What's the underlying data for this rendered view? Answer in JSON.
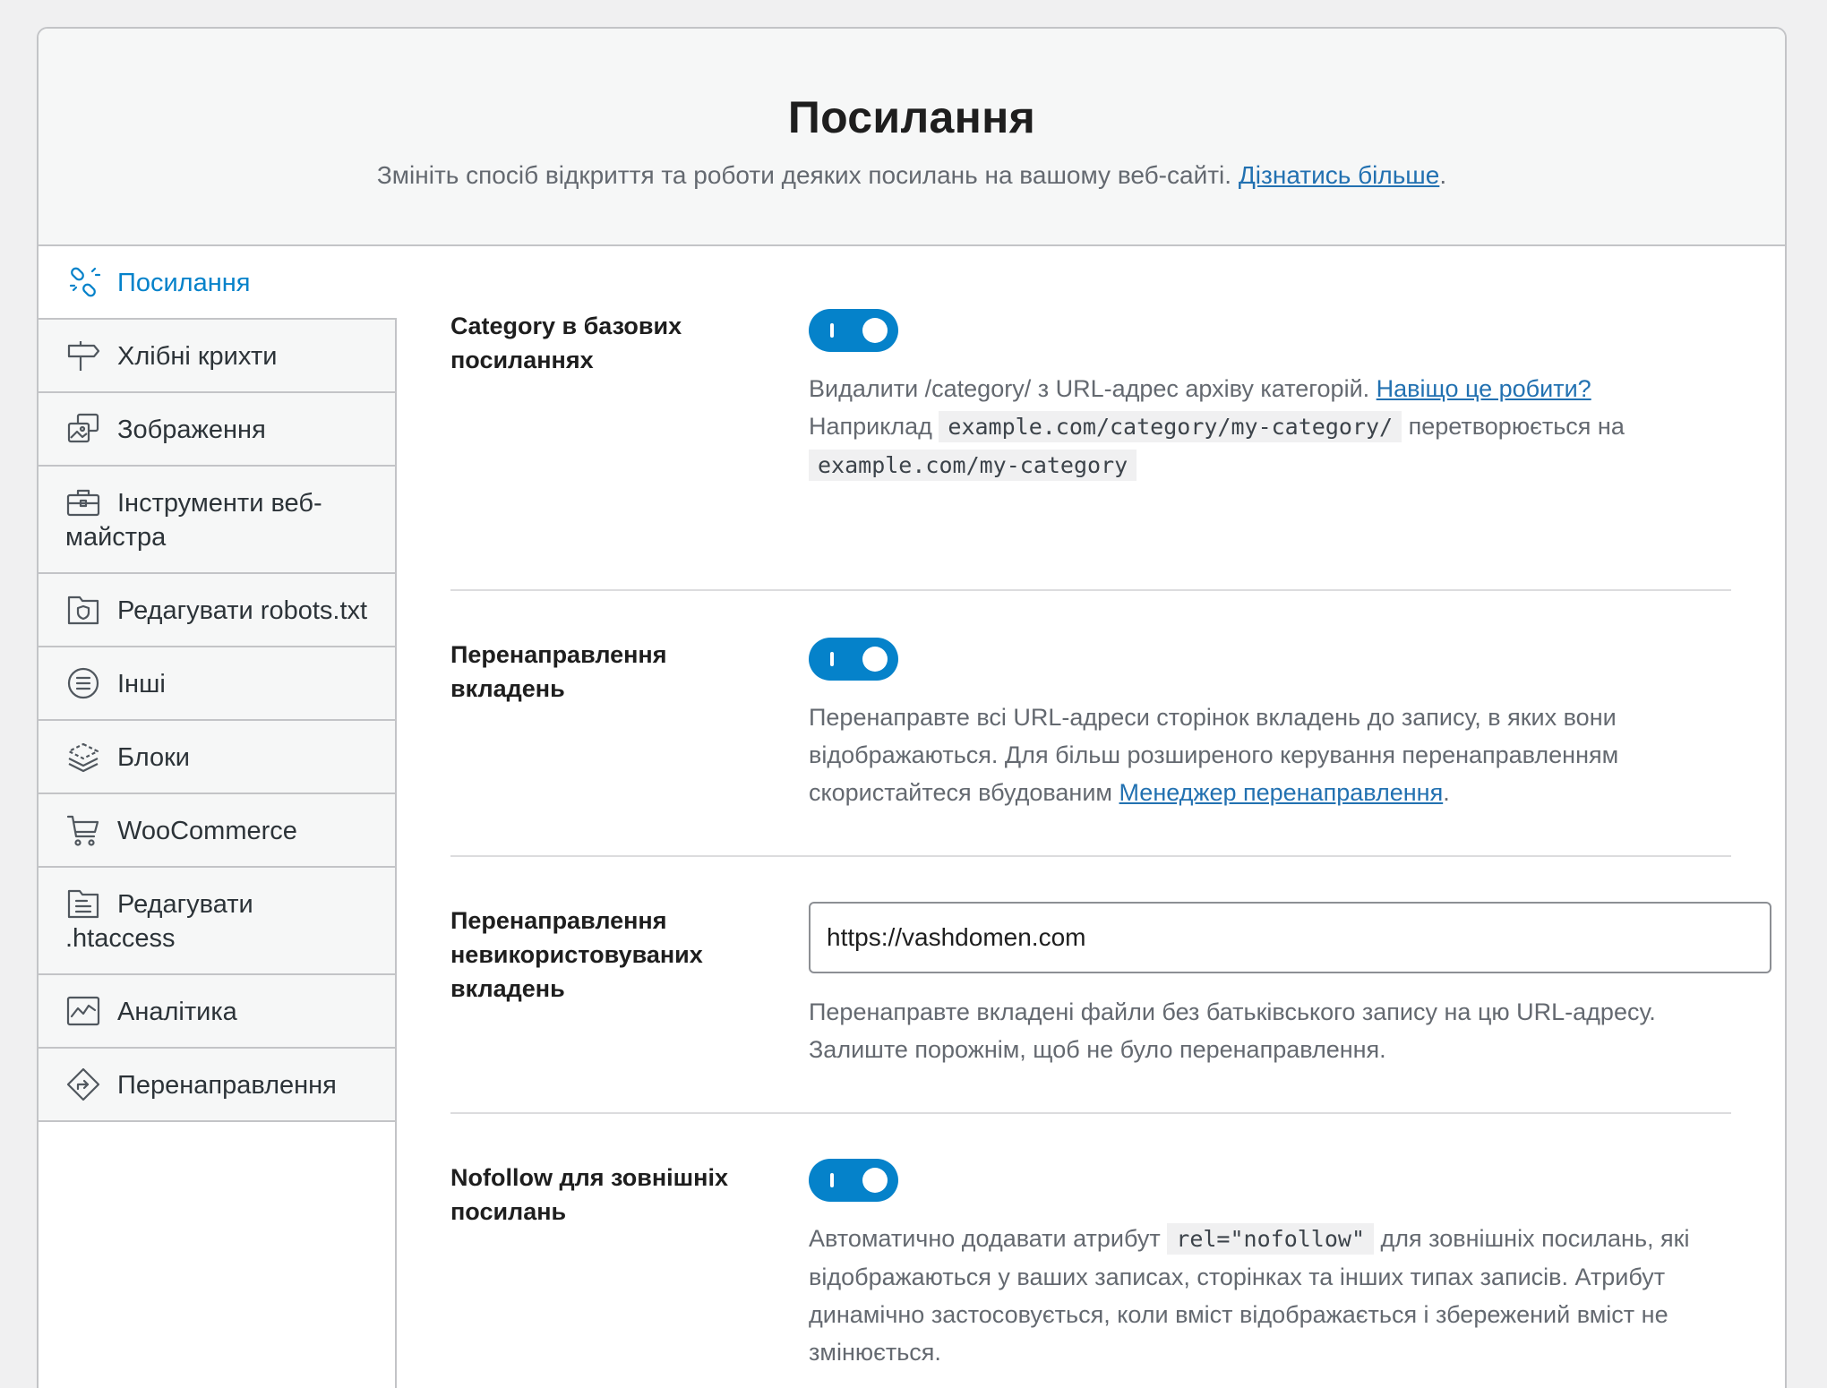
{
  "header": {
    "title": "Посилання",
    "subtitle": "Змініть спосіб відкриття та роботи деяких посилань на вашому веб-сайті.",
    "learn_more": "Дізнатись більше",
    "period": "."
  },
  "sidebar": {
    "items": [
      {
        "label": "Посилання",
        "icon": "broken-link-icon",
        "active": true
      },
      {
        "label": "Хлібні крихти",
        "icon": "signpost-icon"
      },
      {
        "label": "Зображення",
        "icon": "images-icon"
      },
      {
        "label": "Інструменти веб-майстра",
        "icon": "toolbox-icon"
      },
      {
        "label": "Редагувати robots.txt",
        "icon": "robots-file-icon"
      },
      {
        "label": "Інші",
        "icon": "list-circle-icon"
      },
      {
        "label": "Блоки",
        "icon": "blocks-icon"
      },
      {
        "label": "WooCommerce",
        "icon": "cart-icon"
      },
      {
        "label": "Редагувати .htaccess",
        "icon": "file-lines-icon"
      },
      {
        "label": "Аналітика",
        "icon": "analytics-icon"
      },
      {
        "label": "Перенаправлення",
        "icon": "redirect-icon"
      }
    ]
  },
  "settings": {
    "category_base": {
      "label": "Category в базових посиланнях",
      "desc_1": "Видалити /category/ з URL-адрес архіву категорій.",
      "why_link": "Навіщо це робити?",
      "desc_2": "Наприклад",
      "code_1": "example.com/category/my-category/",
      "desc_3": "перетворюється на",
      "code_2": "example.com/my-category"
    },
    "attachment_redirect": {
      "label": "Перенаправлення вкладень",
      "desc": "Перенаправте всі URL-адреси сторінок вкладень до запису, в яких вони відображаються. Для більш розширеного керування перенаправленням скористайтеся вбудованим",
      "manager_link": "Менеджер перенаправлення",
      "period": "."
    },
    "orphan_redirect": {
      "label": "Перенаправлення невикористовуваних вкладень",
      "value": "https://vashdomen.com",
      "desc": "Перенаправте вкладені файли без батьківського запису на цю URL-адресу. Залиште порожнім, щоб не було перенаправлення."
    },
    "nofollow": {
      "label": "Nofollow для зовнішніх посилань",
      "desc_1": "Автоматично додавати атрибут",
      "code": "rel=\"nofollow\"",
      "desc_2": "для зовнішніх посилань, які відображаються у ваших записах, сторінках та інших типах записів. Атрибут динамічно застосовується, коли вміст відображається і збережений вміст не змінюється."
    }
  },
  "colors": {
    "accent": "#0582ca",
    "link": "#2271b1",
    "muted": "#646970",
    "border": "#c3c4c7"
  }
}
